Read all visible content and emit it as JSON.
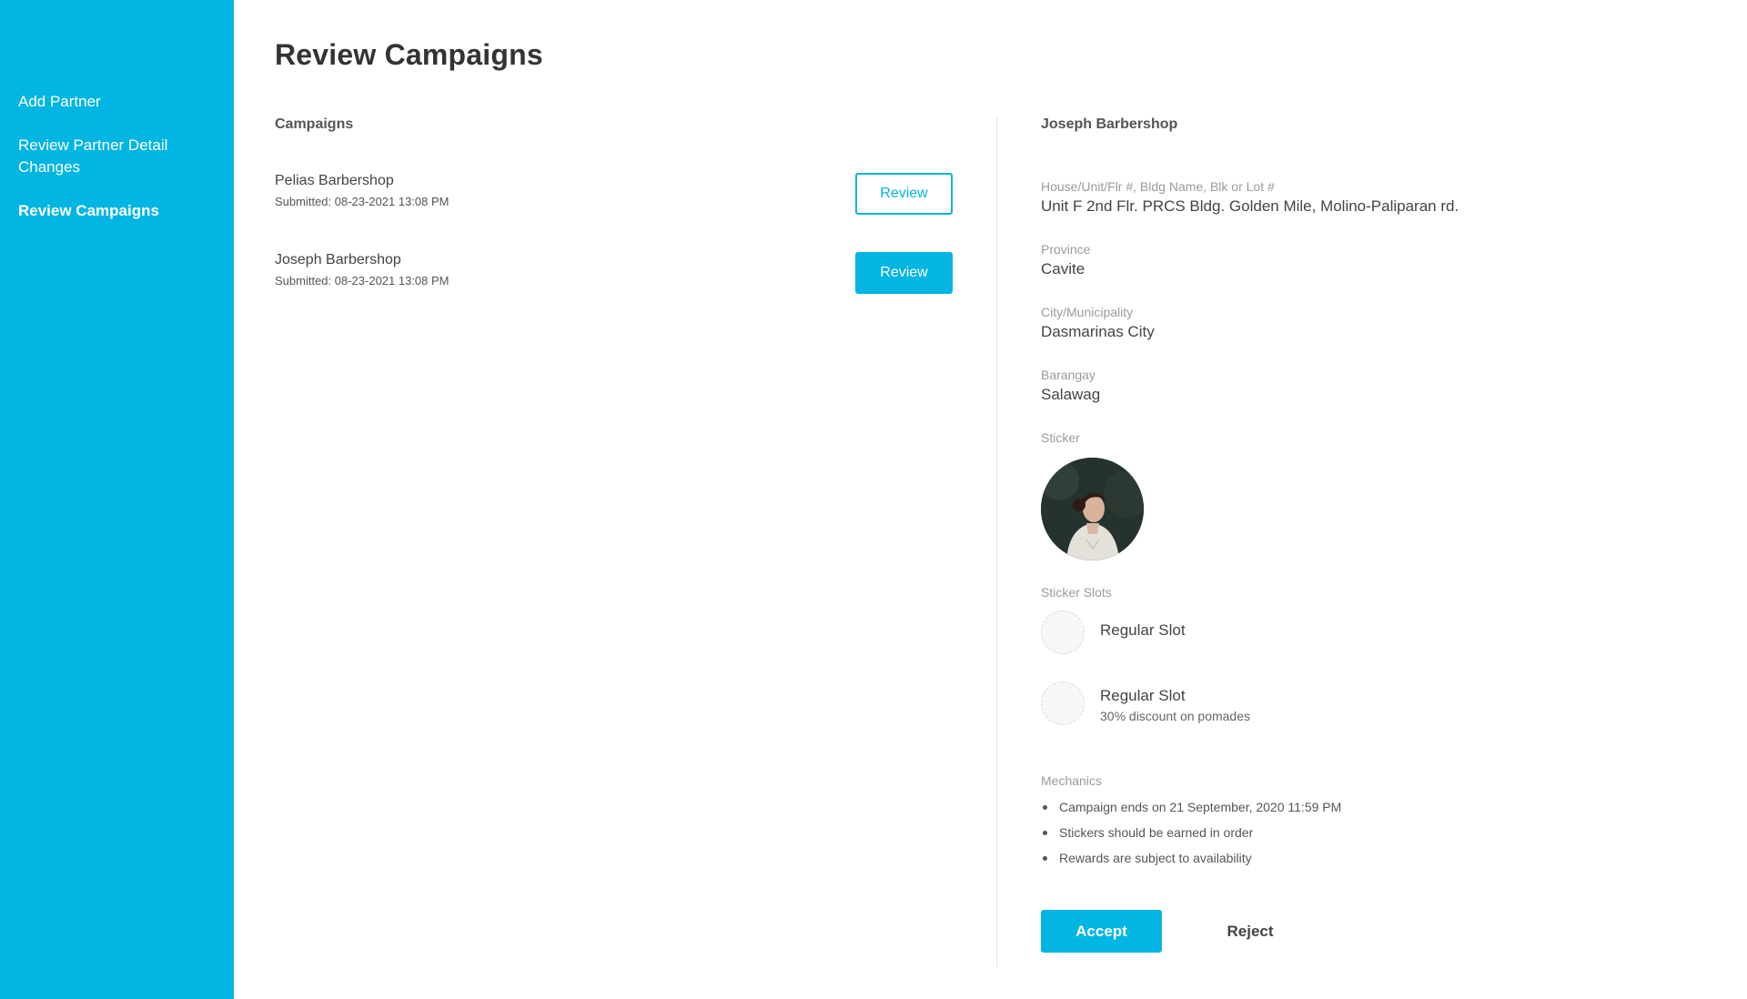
{
  "sidebar": {
    "items": [
      {
        "label": "Add Partner",
        "active": false
      },
      {
        "label": "Review Partner Detail Changes",
        "active": false
      },
      {
        "label": "Review Campaigns",
        "active": true
      }
    ]
  },
  "page": {
    "title": "Review Campaigns"
  },
  "campaigns": {
    "heading": "Campaigns",
    "items": [
      {
        "name": "Pelias Barbershop",
        "submitted": "Submitted: 08-23-2021 13:08 PM",
        "button_label": "Review",
        "selected": false
      },
      {
        "name": "Joseph Barbershop",
        "submitted": "Submitted: 08-23-2021 13:08 PM",
        "button_label": "Review",
        "selected": true
      }
    ]
  },
  "detail": {
    "title": "Joseph Barbershop",
    "address": {
      "label": "House/Unit/Flr #, Bldg Name, Blk or Lot #",
      "value": "Unit F 2nd Flr. PRCS Bldg. Golden Mile, Molino-Paliparan rd."
    },
    "province": {
      "label": "Province",
      "value": "Cavite"
    },
    "city": {
      "label": "City/Municipality",
      "value": "Dasmarinas City"
    },
    "barangay": {
      "label": "Barangay",
      "value": "Salawag"
    },
    "sticker": {
      "label": "Sticker"
    },
    "sticker_slots": {
      "label": "Sticker Slots",
      "items": [
        {
          "title": "Regular Slot",
          "description": ""
        },
        {
          "title": "Regular Slot",
          "description": "30% discount on pomades"
        }
      ]
    },
    "mechanics": {
      "label": "Mechanics",
      "items": [
        "Campaign ends on 21 September, 2020 11:59 PM",
        "Stickers should be earned in order",
        "Rewards are subject to availability"
      ]
    },
    "accept_label": "Accept",
    "reject_label": "Reject"
  },
  "colors": {
    "accent": "#03b5e2",
    "text": "#333333",
    "muted": "#9b9b9b"
  }
}
